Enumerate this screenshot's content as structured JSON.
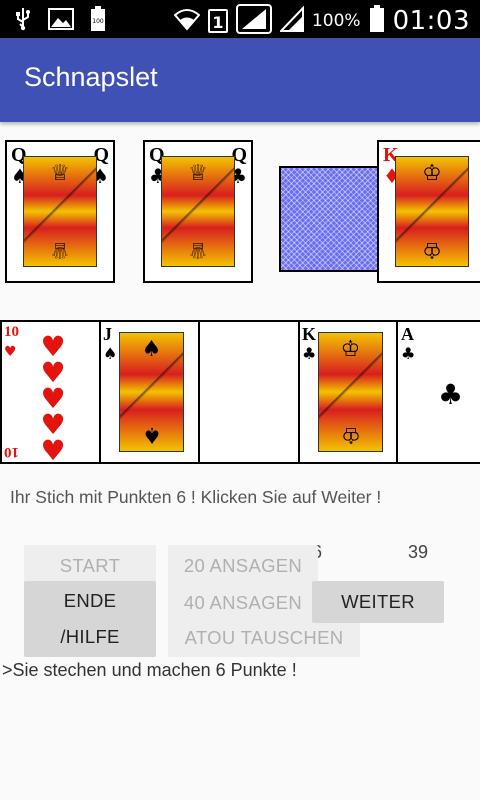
{
  "status_bar": {
    "battery_pct": "100%",
    "time": "01:03",
    "sim": "1",
    "icons": [
      "usb-icon",
      "image-icon",
      "battery-small-icon",
      "wifi-icon",
      "signal-icon",
      "signal-icon",
      "battery-icon"
    ]
  },
  "app": {
    "title": "Schnapslet"
  },
  "opponent_cards": [
    {
      "rank": "Q",
      "suit": "♠",
      "color": "black"
    },
    {
      "rank": "Q",
      "suit": "♣",
      "color": "black"
    }
  ],
  "atout_card": {
    "rank": "K",
    "suit": "♦",
    "color": "red"
  },
  "player_cards": [
    {
      "rank": "10",
      "suit": "♥",
      "color": "red"
    },
    {
      "rank": "J",
      "suit": "♠",
      "color": "black"
    },
    {
      "rank": "",
      "suit": "",
      "color": "black"
    },
    {
      "rank": "K",
      "suit": "♣",
      "color": "black"
    },
    {
      "rank": "A",
      "suit": "♣",
      "color": "black"
    }
  ],
  "message": "Ihr Stich mit Punkten 6 ! Klicken Sie auf Weiter !",
  "scores": {
    "player": "6",
    "opponent": "39"
  },
  "buttons": {
    "start": "START",
    "ende_hilfe_1": "ENDE",
    "ende_hilfe_2": "/HILFE",
    "ansagen_20": "20 ANSAGEN",
    "ansagen_40": "40 ANSAGEN",
    "atou_tauschen": "ATOU TAUSCHEN",
    "weiter": "WEITER"
  },
  "log": ">Sie stechen und machen 6 Punkte !"
}
